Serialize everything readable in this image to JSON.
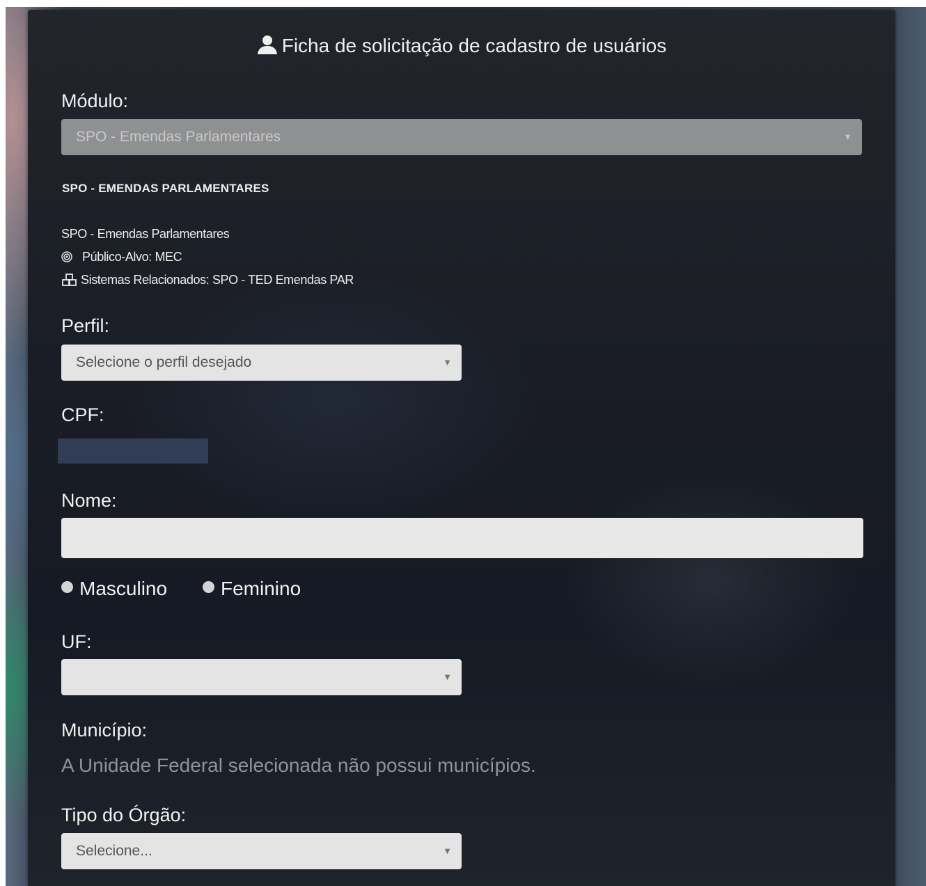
{
  "form": {
    "title": "Ficha de solicitação de cadastro de usuários",
    "title_icon": "user-icon",
    "modulo": {
      "label": "Módulo:",
      "selected": "SPO - Emendas Parlamentares",
      "disabled": true
    },
    "module_info": {
      "heading": "SPO - EMENDAS PARLAMENTARES",
      "name": "SPO - Emendas Parlamentares",
      "publico_alvo": "Público-Alvo: MEC",
      "publico_alvo_icon": "target-icon",
      "sistemas": "Sistemas Relacionados: SPO - TED Emendas PAR",
      "sistemas_icon": "cubes-icon"
    },
    "perfil": {
      "label": "Perfil:",
      "selected": "Selecione o perfil desejado"
    },
    "cpf": {
      "label": "CPF:"
    },
    "nome": {
      "label": "Nome:",
      "value": ""
    },
    "sexo": {
      "options": [
        "Masculino",
        "Feminino"
      ]
    },
    "uf": {
      "label": "UF:",
      "selected": ""
    },
    "municipio": {
      "label": "Município:",
      "message": "A Unidade Federal selecionada não possui municípios."
    },
    "tipo_orgao": {
      "label": "Tipo do Órgão:",
      "selected": "Selecione..."
    }
  },
  "colors": {
    "panel_bg": "#1a1d25",
    "input_bg": "#e4e4e4",
    "disabled_bg": "#8f9092",
    "text": "#f2f2f2",
    "hint_text": "#8c939c"
  }
}
